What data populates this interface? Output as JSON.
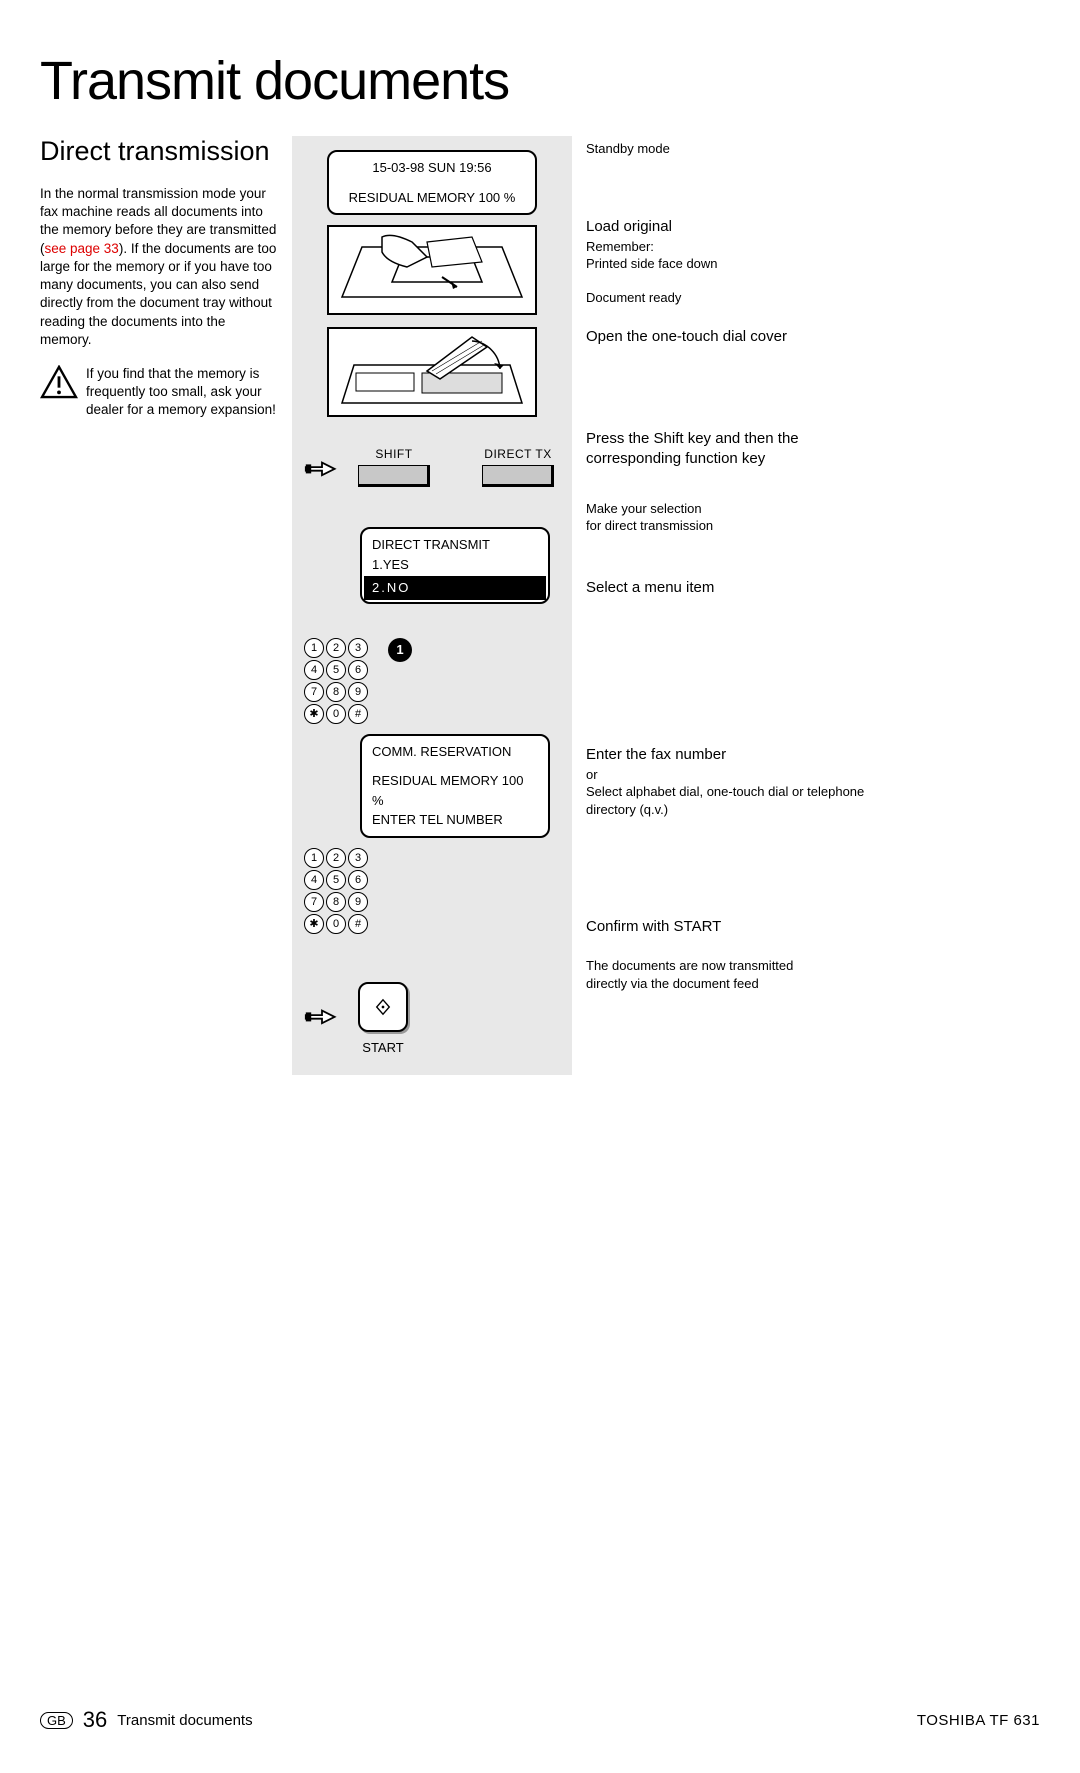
{
  "title": "Transmit documents",
  "subtitle": "Direct  transmission",
  "body_text_1": "In the normal transmission mode your fax machine reads all documents into the memory before they are transmitted (",
  "body_text_link": "see page 33",
  "body_text_2": "). If the documents are too large for the memory or if you have too many documents, you can also send directly from the document tray without reading the documents into the memory.",
  "warn_text": "If you find that the memory is frequently too small, ask your dealer for a memory expansion!",
  "lcd1_line1": "15-03-98   SUN    19:56",
  "lcd1_line2": "RESIDUAL MEMORY 100 %",
  "btn_shift": "SHIFT",
  "btn_directtx": "DIRECT TX",
  "lcd2_line1": "DIRECT TRANSMIT",
  "lcd2_line2": "1.YES",
  "lcd2_line3": "2.NO",
  "sel_btn": "1",
  "lcd3_line1": "COMM. RESERVATION",
  "lcd3_line2": "RESIDUAL MEMORY 100 %",
  "lcd3_line3": "ENTER TEL NUMBER",
  "start_label": "START",
  "keypad": [
    "1",
    "2",
    "3",
    "4",
    "5",
    "6",
    "7",
    "8",
    "9",
    "✱",
    "0",
    "#"
  ],
  "r": {
    "standby": "Standby mode",
    "load_head": "Load original",
    "load_sub1": "Remember:",
    "load_sub2": "Printed side face down",
    "docready": "Document ready",
    "cover": "Open the one-touch dial cover",
    "shift_head": "Press the Shift key and then the corresponding function key",
    "makesel1": "Make your selection",
    "makesel2": "for direct transmission",
    "selmenu": "Select a menu item",
    "enter_head": "Enter the fax number",
    "enter_or": "or",
    "enter_sub": "Select alphabet dial, one-touch dial or telephone directory (q.v.)",
    "confirm": "Confirm with START",
    "final1": "The documents are now transmitted",
    "final2": "directly via the document feed"
  },
  "footer": {
    "gb": "GB",
    "page": "36",
    "chapter": "Transmit documents",
    "brand": "TOSHIBA    TF 631"
  }
}
